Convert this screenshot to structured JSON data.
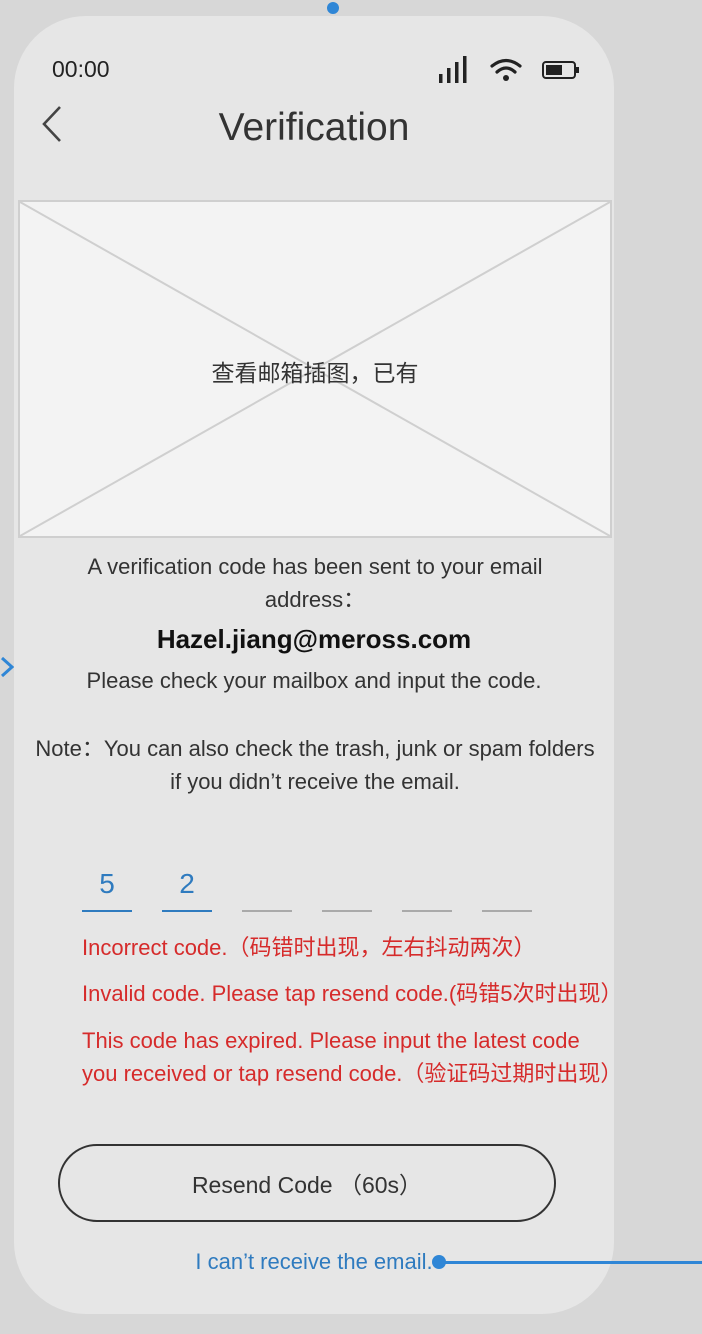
{
  "status_bar": {
    "time": "00:00",
    "icons": [
      "signal-icon",
      "wifi-icon",
      "battery-icon"
    ]
  },
  "header": {
    "back_icon": "chevron-left-icon",
    "title": "Verification"
  },
  "illustration": {
    "label": "查看邮箱插图，已有"
  },
  "info": {
    "sent_text": "A verification code has been sent to your email address：",
    "email": "Hazel.jiang@meross.com",
    "check_text": "Please check your mailbox and input the code.",
    "note_text": "Note：You can also check the trash, junk or spam folders if you didn’t receive the email."
  },
  "code": {
    "digits": [
      "5",
      "2",
      "",
      "",
      "",
      ""
    ]
  },
  "errors": {
    "incorrect": "Incorrect code.（码错时出现，左右抖动两次）",
    "invalid": "Invalid code. Please tap resend code.(码错5次时出现）",
    "expired": "This code has expired. Please input the latest code you received or tap resend code.（验证码过期时出现）"
  },
  "actions": {
    "resend_label": "Resend Code （60s）",
    "cant_receive_label": "I can’t receive the email."
  },
  "colors": {
    "accent": "#2f7bbf",
    "error": "#d62b2b",
    "connector": "#2f86d6"
  }
}
